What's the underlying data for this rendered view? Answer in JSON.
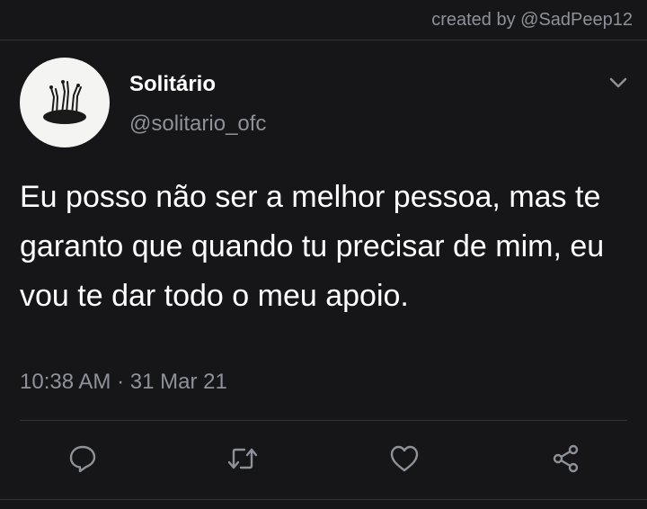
{
  "credit": "created by @SadPeep12",
  "author": {
    "display_name": "Solitário",
    "handle": "@solitario_ofc"
  },
  "tweet": {
    "text": "Eu posso não ser a melhor pessoa, mas te garanto que quando tu precisar de mim, eu vou te dar todo o meu apoio.",
    "time": "10:38 AM",
    "separator": " · ",
    "date": "31 Mar 21"
  },
  "actions": [
    "reply-icon",
    "retweet-icon",
    "like-icon",
    "share-icon"
  ],
  "colors": {
    "background": "#161618",
    "primary_text": "#ffffff",
    "secondary_text": "#8e9197",
    "divider": "#2f3336"
  }
}
